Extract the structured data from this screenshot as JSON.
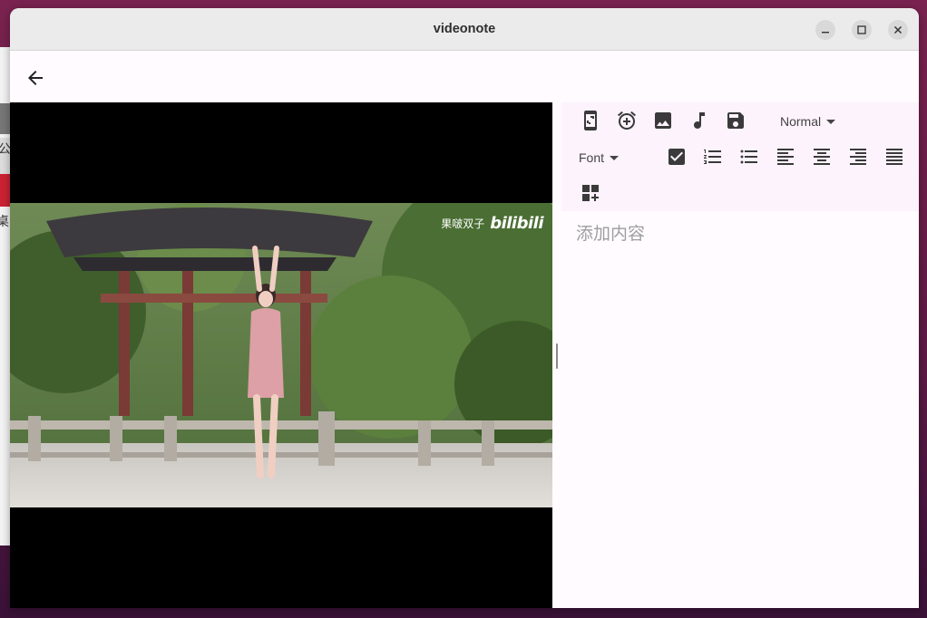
{
  "window": {
    "title": "videonote"
  },
  "background": {
    "char1": "公",
    "char2": "桌"
  },
  "video": {
    "watermark_text": "果啵双子",
    "watermark_logo": "bilibili"
  },
  "editor": {
    "heading_dropdown": "Normal",
    "font_dropdown": "Font",
    "placeholder": "添加内容"
  },
  "icons": {
    "back": "arrow-back-icon",
    "screenshot": "phone-screenshot-icon",
    "timestamp": "alarm-add-icon",
    "image": "image-icon",
    "audio": "music-note-icon",
    "save": "save-icon",
    "checklist": "checkbox-icon",
    "ordered_list": "ordered-list-icon",
    "bullet_list": "bullet-list-icon",
    "align_left": "align-left-icon",
    "align_center": "align-center-icon",
    "align_right": "align-right-icon",
    "align_justify": "align-justify-icon",
    "add_widget": "add-widget-icon"
  }
}
